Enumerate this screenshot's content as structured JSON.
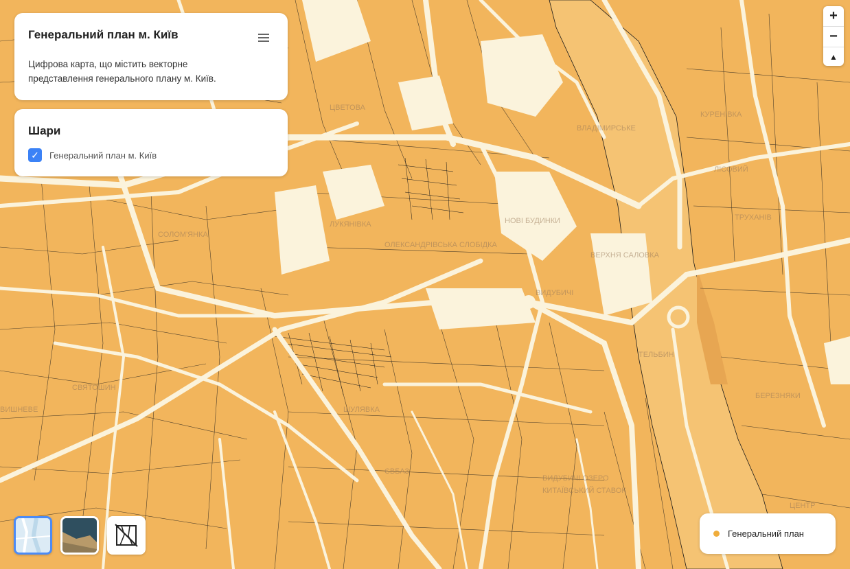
{
  "info": {
    "title": "Генеральний план м. Київ",
    "description": "Цифрова карта, що містить векторне представлення генерального плану м. Київ.",
    "menu_icon": "hamburger-menu-icon"
  },
  "layers": {
    "title": "Шари",
    "items": [
      {
        "label": "Генеральний план м. Київ",
        "checked": true
      }
    ]
  },
  "zoom": {
    "in_label": "+",
    "out_label": "−",
    "north_label": "▲"
  },
  "basemaps": [
    {
      "name": "light",
      "selected": true
    },
    {
      "name": "satellite",
      "selected": false
    },
    {
      "name": "none",
      "selected": false
    }
  ],
  "legend": {
    "label": "Генеральний план",
    "color": "#f0ad3c"
  },
  "map": {
    "fill_color": "#f2b55c",
    "road_color": "#fbf3dc",
    "river_color": "#e0a85a",
    "labels": [
      "ЦВЕТОВА",
      "ВЛАДІМИРСЬКЕ",
      "КУРЕНІВКА",
      "ЛУКЯНІВКА",
      "ОЛЕКСАНДРІВСЬКА СЛОБІДКА",
      "НОВІ БУДИНКИ",
      "ВИДУБИЧІ",
      "ВЕРХНЯ САЛОВКА",
      "СВЯТОШИН",
      "ШУЛЯВКА",
      "ЄВБАЗ",
      "СОЛОМ'ЯНКА",
      "ВИДУБИЧІ ОЗЕРО",
      "КИТАЇВСЬКИЙ СТАВОК",
      "ЛІСОВИЙ",
      "ТРУХАНІВ",
      "БЕРЕЗНЯКИ",
      "ТЕЛЬБИН",
      "ЦЕНТР",
      "ВИШНЕВЕ"
    ]
  }
}
